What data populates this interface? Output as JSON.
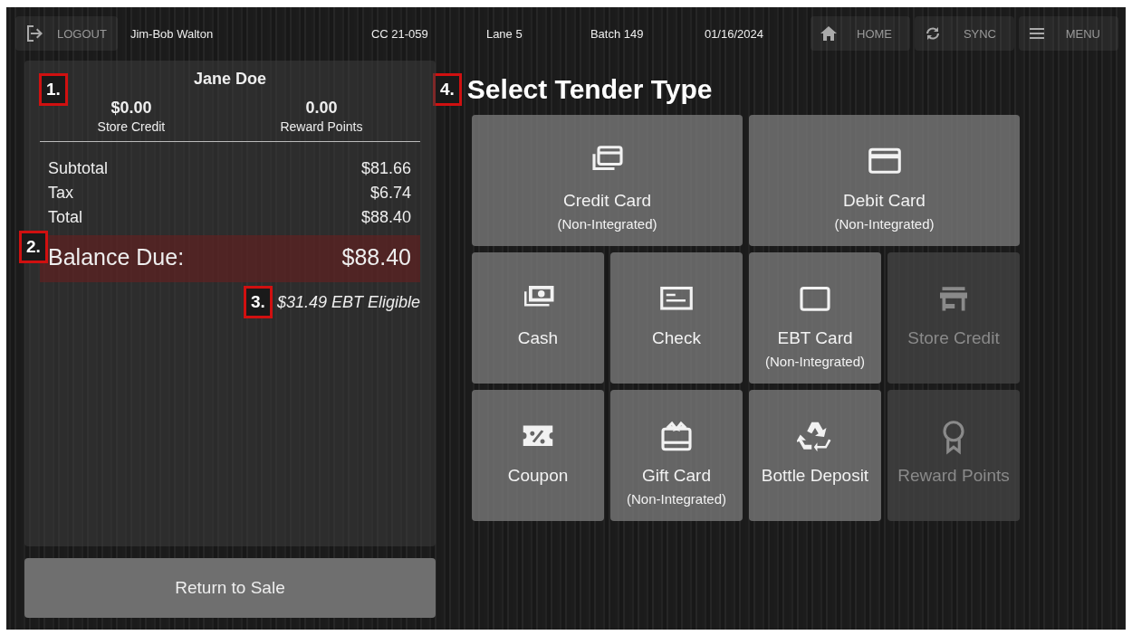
{
  "header": {
    "logout": "LOGOUT",
    "cashier": "Jim-Bob Walton",
    "register": "CC 21-059",
    "lane": "Lane 5",
    "batch": "Batch 149",
    "date": "01/16/2024",
    "buttons": [
      {
        "label": "HOME"
      },
      {
        "label": "SYNC"
      },
      {
        "label": "MENU"
      }
    ]
  },
  "customer": {
    "callout": "1.",
    "name": "Jane Doe",
    "stats": [
      {
        "value": "$0.00",
        "label": "Store Credit"
      },
      {
        "value": "0.00",
        "label": "Reward Points"
      }
    ]
  },
  "totals": {
    "rows": [
      {
        "label": "Subtotal",
        "value": "$81.66"
      },
      {
        "label": "Tax",
        "value": "$6.74"
      },
      {
        "label": "Total",
        "value": "$88.40"
      }
    ],
    "callout": "2.",
    "balance_label": "Balance Due:",
    "balance_value": "$88.40",
    "ebt_callout": "3.",
    "ebt_note": "$31.49 EBT Eligible"
  },
  "return_button": "Return to Sale",
  "tender": {
    "callout": "4.",
    "title": "Select Tender Type",
    "tiles": [
      {
        "label": "Credit Card",
        "sub": "(Non-Integrated)",
        "disabled": false
      },
      {
        "label": "Debit Card",
        "sub": "(Non-Integrated)",
        "disabled": false
      },
      {
        "label": "Cash",
        "disabled": false
      },
      {
        "label": "Check",
        "disabled": false
      },
      {
        "label": "EBT Card",
        "sub": "(Non-Integrated)",
        "disabled": false
      },
      {
        "label": "Store Credit",
        "disabled": true
      },
      {
        "label": "Coupon",
        "disabled": false
      },
      {
        "label": "Gift Card",
        "sub": "(Non-Integrated)",
        "disabled": false
      },
      {
        "label": "Bottle Deposit",
        "disabled": false
      },
      {
        "label": "Reward Points",
        "disabled": true
      }
    ]
  }
}
